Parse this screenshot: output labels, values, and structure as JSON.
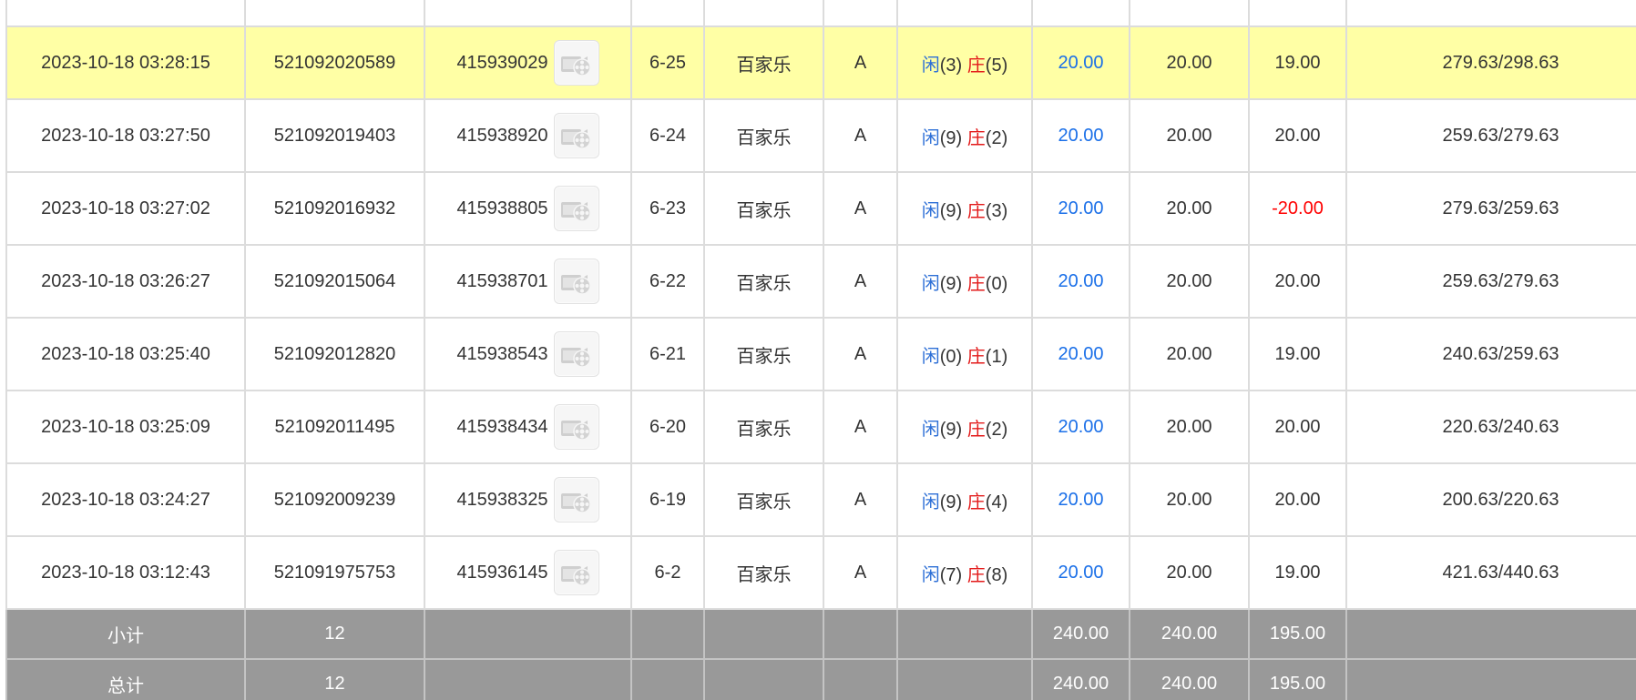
{
  "colors": {
    "highlight_row": "#ffffa5",
    "summary_bg": "#999999",
    "player_blue": "#2d6fd6",
    "banker_red": "#e31b1b",
    "bet_blue": "#1a6fe8",
    "negative_red": "#ff0000"
  },
  "icons": {
    "replay": "video-replay-icon"
  },
  "rows": [
    {
      "time": "",
      "bet_id": "",
      "round_id": "",
      "shoe": "",
      "game": "",
      "table": "",
      "player_label": "",
      "player_score": "",
      "banker_label": "",
      "banker_score": "",
      "bet_amount": "",
      "valid_bet": "",
      "win_loss": "",
      "balance": ""
    },
    {
      "time": "2023-10-18 03:28:15",
      "bet_id": "521092020589",
      "round_id": "415939029",
      "shoe": "6-25",
      "game": "百家乐",
      "table": "A",
      "player_label": "闲",
      "player_score": "(3)",
      "banker_label": "庄",
      "banker_score": "(5)",
      "bet_amount": "20.00",
      "valid_bet": "20.00",
      "win_loss": "19.00",
      "balance": "279.63/298.63"
    },
    {
      "time": "2023-10-18 03:27:50",
      "bet_id": "521092019403",
      "round_id": "415938920",
      "shoe": "6-24",
      "game": "百家乐",
      "table": "A",
      "player_label": "闲",
      "player_score": "(9)",
      "banker_label": "庄",
      "banker_score": "(2)",
      "bet_amount": "20.00",
      "valid_bet": "20.00",
      "win_loss": "20.00",
      "balance": "259.63/279.63"
    },
    {
      "time": "2023-10-18 03:27:02",
      "bet_id": "521092016932",
      "round_id": "415938805",
      "shoe": "6-23",
      "game": "百家乐",
      "table": "A",
      "player_label": "闲",
      "player_score": "(9)",
      "banker_label": "庄",
      "banker_score": "(3)",
      "bet_amount": "20.00",
      "valid_bet": "20.00",
      "win_loss": "-20.00",
      "balance": "279.63/259.63"
    },
    {
      "time": "2023-10-18 03:26:27",
      "bet_id": "521092015064",
      "round_id": "415938701",
      "shoe": "6-22",
      "game": "百家乐",
      "table": "A",
      "player_label": "闲",
      "player_score": "(9)",
      "banker_label": "庄",
      "banker_score": "(0)",
      "bet_amount": "20.00",
      "valid_bet": "20.00",
      "win_loss": "20.00",
      "balance": "259.63/279.63"
    },
    {
      "time": "2023-10-18 03:25:40",
      "bet_id": "521092012820",
      "round_id": "415938543",
      "shoe": "6-21",
      "game": "百家乐",
      "table": "A",
      "player_label": "闲",
      "player_score": "(0)",
      "banker_label": "庄",
      "banker_score": "(1)",
      "bet_amount": "20.00",
      "valid_bet": "20.00",
      "win_loss": "19.00",
      "balance": "240.63/259.63"
    },
    {
      "time": "2023-10-18 03:25:09",
      "bet_id": "521092011495",
      "round_id": "415938434",
      "shoe": "6-20",
      "game": "百家乐",
      "table": "A",
      "player_label": "闲",
      "player_score": "(9)",
      "banker_label": "庄",
      "banker_score": "(2)",
      "bet_amount": "20.00",
      "valid_bet": "20.00",
      "win_loss": "20.00",
      "balance": "220.63/240.63"
    },
    {
      "time": "2023-10-18 03:24:27",
      "bet_id": "521092009239",
      "round_id": "415938325",
      "shoe": "6-19",
      "game": "百家乐",
      "table": "A",
      "player_label": "闲",
      "player_score": "(9)",
      "banker_label": "庄",
      "banker_score": "(4)",
      "bet_amount": "20.00",
      "valid_bet": "20.00",
      "win_loss": "20.00",
      "balance": "200.63/220.63"
    },
    {
      "time": "2023-10-18 03:12:43",
      "bet_id": "521091975753",
      "round_id": "415936145",
      "shoe": "6-2",
      "game": "百家乐",
      "table": "A",
      "player_label": "闲",
      "player_score": "(7)",
      "banker_label": "庄",
      "banker_score": "(8)",
      "bet_amount": "20.00",
      "valid_bet": "20.00",
      "win_loss": "19.00",
      "balance": "421.63/440.63"
    }
  ],
  "subtotal": {
    "label": "小计",
    "count": "12",
    "bet_amount": "240.00",
    "valid_bet": "240.00",
    "win_loss": "195.00"
  },
  "total": {
    "label": "总计",
    "count": "12",
    "bet_amount": "240.00",
    "valid_bet": "240.00",
    "win_loss": "195.00"
  }
}
